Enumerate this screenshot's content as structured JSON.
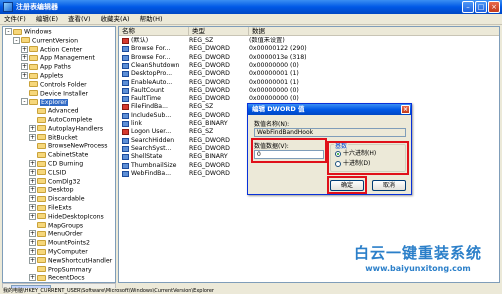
{
  "window": {
    "title": "注册表编辑器"
  },
  "menu": [
    "文件(F)",
    "编辑(E)",
    "查看(V)",
    "收藏夹(A)",
    "帮助(H)"
  ],
  "tree": [
    {
      "label": "Windows",
      "indent": 0,
      "expander": "-"
    },
    {
      "label": "CurrentVersion",
      "indent": 1,
      "expander": "-"
    },
    {
      "label": "Action Center",
      "indent": 2,
      "expander": "+"
    },
    {
      "label": "App Management",
      "indent": 2,
      "expander": "+"
    },
    {
      "label": "App Paths",
      "indent": 2,
      "expander": "+"
    },
    {
      "label": "Applets",
      "indent": 2,
      "expander": "+"
    },
    {
      "label": "Controls Folder",
      "indent": 2,
      "expander": ""
    },
    {
      "label": "Device Installer",
      "indent": 2,
      "expander": ""
    },
    {
      "label": "Explorer",
      "indent": 2,
      "expander": "-"
    },
    {
      "label": "Advanced",
      "indent": 3,
      "expander": ""
    },
    {
      "label": "AutoComplete",
      "indent": 3,
      "expander": ""
    },
    {
      "label": "AutoplayHandlers",
      "indent": 3,
      "expander": "+"
    },
    {
      "label": "BitBucket",
      "indent": 3,
      "expander": "+"
    },
    {
      "label": "BrowseNewProcess",
      "indent": 3,
      "expander": ""
    },
    {
      "label": "CabinetState",
      "indent": 3,
      "expander": ""
    },
    {
      "label": "CD Burning",
      "indent": 3,
      "expander": "+"
    },
    {
      "label": "CLSID",
      "indent": 3,
      "expander": "+"
    },
    {
      "label": "ComDlg32",
      "indent": 3,
      "expander": "+"
    },
    {
      "label": "Desktop",
      "indent": 3,
      "expander": "+"
    },
    {
      "label": "Discardable",
      "indent": 3,
      "expander": "+"
    },
    {
      "label": "FileExts",
      "indent": 3,
      "expander": "+"
    },
    {
      "label": "HideDesktopIcons",
      "indent": 3,
      "expander": "+"
    },
    {
      "label": "MapGroups",
      "indent": 3,
      "expander": ""
    },
    {
      "label": "MenuOrder",
      "indent": 3,
      "expander": "+"
    },
    {
      "label": "MountPoints2",
      "indent": 3,
      "expander": "+"
    },
    {
      "label": "MyComputer",
      "indent": 3,
      "expander": "+"
    },
    {
      "label": "NewShortcutHandler",
      "indent": 3,
      "expander": "+"
    },
    {
      "label": "PropSummary",
      "indent": 3,
      "expander": ""
    },
    {
      "label": "RecentDocs",
      "indent": 3,
      "expander": "+"
    }
  ],
  "list": {
    "columns": [
      "名称",
      "类型",
      "数据"
    ],
    "rows": [
      {
        "name": "(默认)",
        "type": "REG_SZ",
        "data": "(数值未设置)",
        "kind": "ab"
      },
      {
        "name": "Browse For...",
        "type": "REG_DWORD",
        "data": "0x00000122 (290)",
        "kind": "dw"
      },
      {
        "name": "Browse For...",
        "type": "REG_DWORD",
        "data": "0x0000013e (318)",
        "kind": "dw"
      },
      {
        "name": "CleanShutdown",
        "type": "REG_DWORD",
        "data": "0x00000000 (0)",
        "kind": "dw"
      },
      {
        "name": "DesktopPro...",
        "type": "REG_DWORD",
        "data": "0x00000001 (1)",
        "kind": "dw"
      },
      {
        "name": "EnableAuto...",
        "type": "REG_DWORD",
        "data": "0x00000001 (1)",
        "kind": "dw"
      },
      {
        "name": "FaultCount",
        "type": "REG_DWORD",
        "data": "0x00000000 (0)",
        "kind": "dw"
      },
      {
        "name": "FaultTime",
        "type": "REG_DWORD",
        "data": "0x00000000 (0)",
        "kind": "dw"
      },
      {
        "name": "FileFindBa...",
        "type": "REG_SZ",
        "data": "",
        "kind": "ab"
      },
      {
        "name": "IncludeSub...",
        "type": "REG_DWORD",
        "data": "",
        "kind": "dw"
      },
      {
        "name": "link",
        "type": "REG_BINARY",
        "data": "",
        "kind": "dw"
      },
      {
        "name": "Logon User...",
        "type": "REG_SZ",
        "data": "",
        "kind": "ab"
      },
      {
        "name": "SearchHidden",
        "type": "REG_DWORD",
        "data": "",
        "kind": "dw"
      },
      {
        "name": "SearchSyst...",
        "type": "REG_DWORD",
        "data": "",
        "kind": "dw"
      },
      {
        "name": "ShellState",
        "type": "REG_BINARY",
        "data": "",
        "kind": "dw"
      },
      {
        "name": "ThumbnailSize",
        "type": "REG_DWORD",
        "data": "",
        "kind": "dw"
      },
      {
        "name": "WebFindBa...",
        "type": "REG_DWORD",
        "data": "",
        "kind": "dw"
      }
    ]
  },
  "dialog": {
    "title": "编辑 DWORD 值",
    "value_name_label": "数值名称(N):",
    "value_name": "WebFindBandHook",
    "value_data_label": "数值数据(V):",
    "value_data": "0",
    "base_label": "基数",
    "hex_label": "十六进制(H)",
    "dec_label": "十进制(D)",
    "ok_label": "确定",
    "cancel_label": "取消"
  },
  "status": "我的电脑\\HKEY_CURRENT_USER\\Software\\Microsoft\\Windows\\CurrentVersion\\Explorer",
  "watermark": {
    "text": "白云一键重装系统",
    "url": "www.baiyunxitong.com"
  }
}
